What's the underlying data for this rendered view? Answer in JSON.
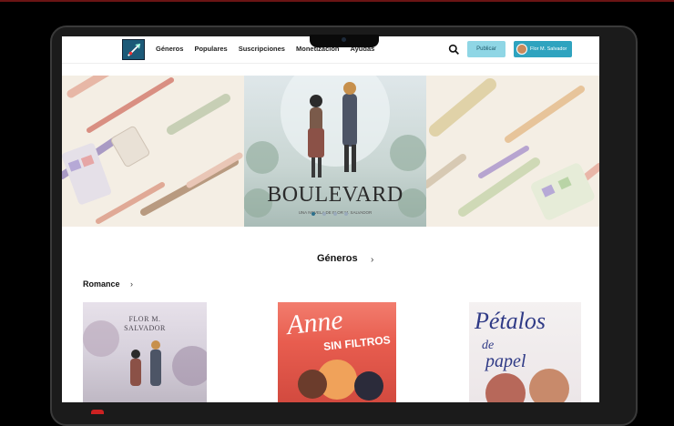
{
  "header": {
    "nav": [
      "Géneros",
      "Populares",
      "Suscripciones",
      "Monetización",
      "Ayudas"
    ],
    "publish_label": "Publicar",
    "user_name": "Flor M. Salvador"
  },
  "banner": {
    "title": "BOULEVARD",
    "subtitle": "UNA NOVELA DE FLOR M. SALVADOR",
    "slide_count": 4,
    "active_slide": 1
  },
  "genres": {
    "title": "Géneros",
    "row_title": "Romance",
    "books": [
      {
        "lines": [
          "FLOR M.",
          "SALVADOR"
        ]
      },
      {
        "lines": [
          "Anne",
          "SIN FILTROS"
        ]
      },
      {
        "lines": [
          "Pétalos",
          "de",
          "papel"
        ]
      }
    ]
  },
  "colors": {
    "accent": "#2fa3bf",
    "publish_bg": "#8fd6e5",
    "logo_bg": "#1c5a78"
  }
}
